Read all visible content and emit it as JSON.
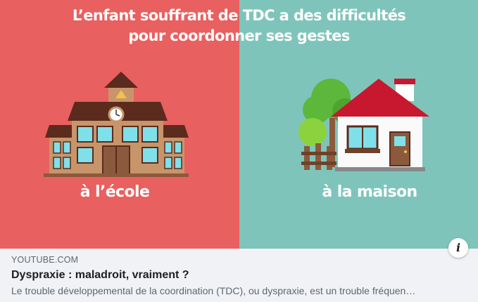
{
  "thumbnail": {
    "headline_line1": "L’enfant souffrant de TDC a des difficultés",
    "headline_line2": "pour coordonner ses gestes",
    "caption_left": "à l’école",
    "caption_right": "à la maison",
    "colors": {
      "left_bg": "#e8605f",
      "right_bg": "#7fc4bb"
    }
  },
  "link": {
    "source": "YOUTUBE.COM",
    "title": "Dyspraxie : maladroit, vraiment ?",
    "description": "Le trouble développemental de la coordination (TDC), ou dyspraxie, est un trouble fréquen…",
    "info_icon": "i"
  }
}
